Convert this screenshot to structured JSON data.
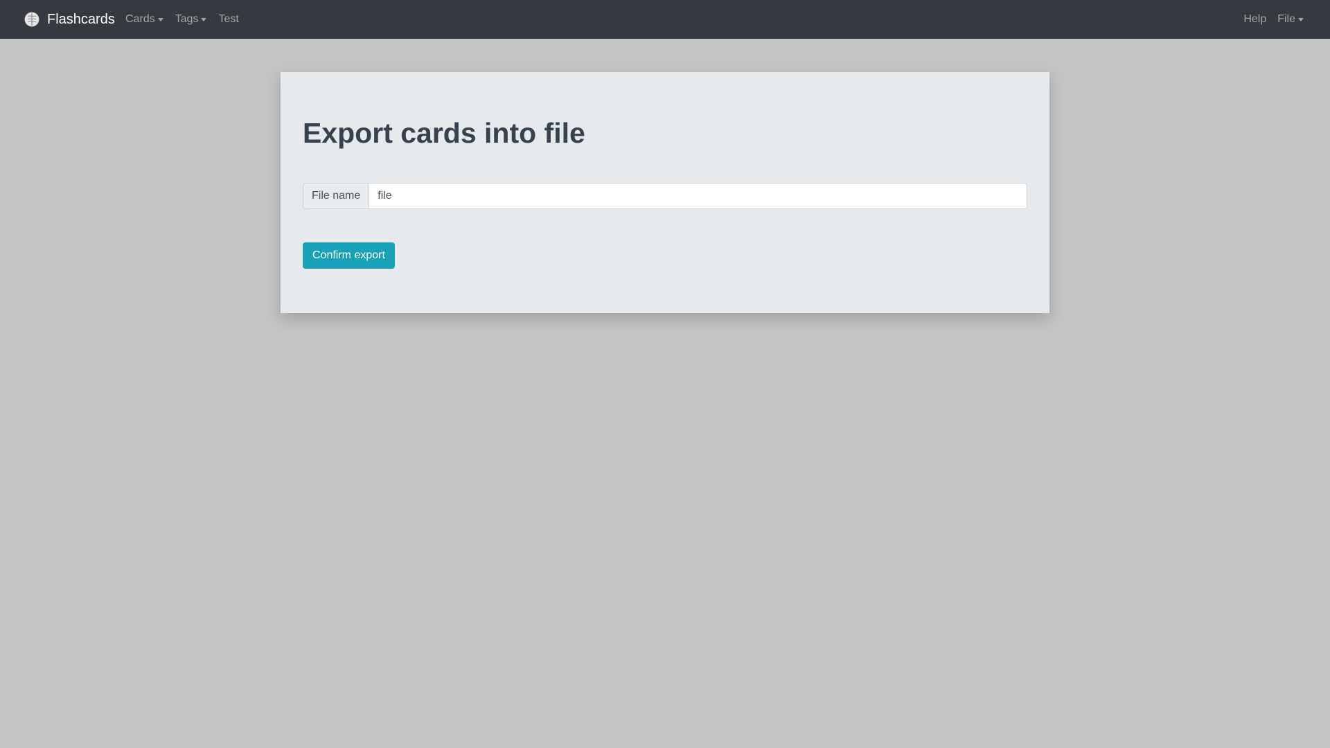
{
  "navbar": {
    "brand": {
      "label": "Flashcards",
      "icon": "brain-icon"
    },
    "left_items": [
      {
        "label": "Cards",
        "dropdown": true
      },
      {
        "label": "Tags",
        "dropdown": true
      },
      {
        "label": "Test",
        "dropdown": false
      }
    ],
    "right_items": [
      {
        "label": "Help",
        "dropdown": false
      },
      {
        "label": "File",
        "dropdown": true
      }
    ]
  },
  "main": {
    "title": "Export cards into file",
    "file_name_label": "File name",
    "file_name_value": "file",
    "confirm_label": "Confirm export"
  },
  "colors": {
    "navbar_bg": "#343a40",
    "page_bg": "#c4c4c4",
    "panel_bg": "#e7eaed",
    "button_accent": "#17a2b8"
  }
}
